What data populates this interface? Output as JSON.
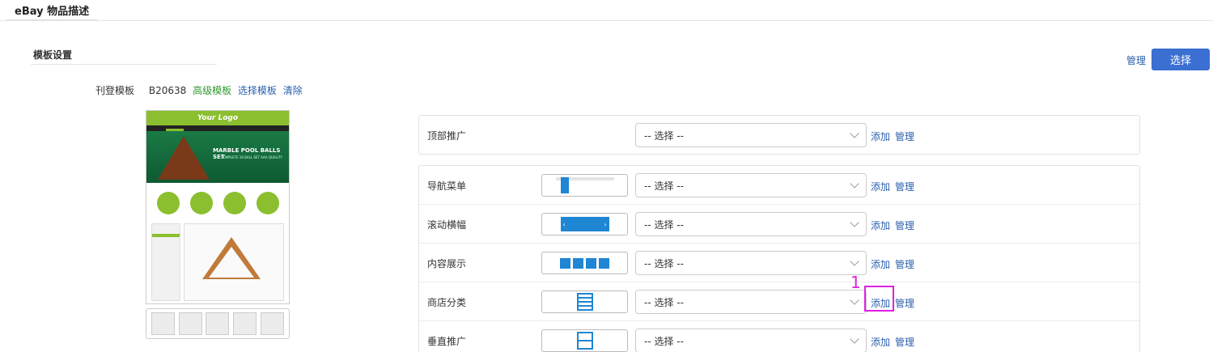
{
  "header": {
    "title": "eBay 物品描述"
  },
  "section": {
    "title": "模板设置"
  },
  "top_actions": {
    "manage_label": "管理",
    "select_label": "选择"
  },
  "template": {
    "label": "刊登模板",
    "code": "B20638",
    "advanced_label": "高级模板",
    "choose_label": "选择模板",
    "clear_label": "清除"
  },
  "preview": {
    "logo_text": "Your Logo",
    "banner_title": "MARBLE POOL BALLS SET",
    "banner_sub": "COMPLETE 16 BALL SET AAA QUALITY"
  },
  "top_module": {
    "label": "顶部推广",
    "select_value": "-- 选择 --",
    "add_label": "添加",
    "manage_label": "管理"
  },
  "modules": [
    {
      "label": "导航菜单",
      "icon": "nav-menu-icon",
      "select_value": "-- 选择 --",
      "add_label": "添加",
      "manage_label": "管理"
    },
    {
      "label": "滚动横幅",
      "icon": "slider-icon",
      "select_value": "-- 选择 --",
      "add_label": "添加",
      "manage_label": "管理"
    },
    {
      "label": "内容展示",
      "icon": "content-grid-icon",
      "select_value": "-- 选择 --",
      "add_label": "添加",
      "manage_label": "管理"
    },
    {
      "label": "商店分类",
      "icon": "category-list-icon",
      "select_value": "-- 选择 --",
      "add_label": "添加",
      "manage_label": "管理"
    },
    {
      "label": "垂直推广",
      "icon": "vertical-promo-icon",
      "select_value": "-- 选择 --",
      "add_label": "添加",
      "manage_label": "管理"
    }
  ],
  "annotation": {
    "number": "1"
  },
  "colors": {
    "primary": "#3b6fd1",
    "link": "#2a5fac",
    "advanced": "#2e9a2e",
    "annotation": "#e020e0"
  }
}
